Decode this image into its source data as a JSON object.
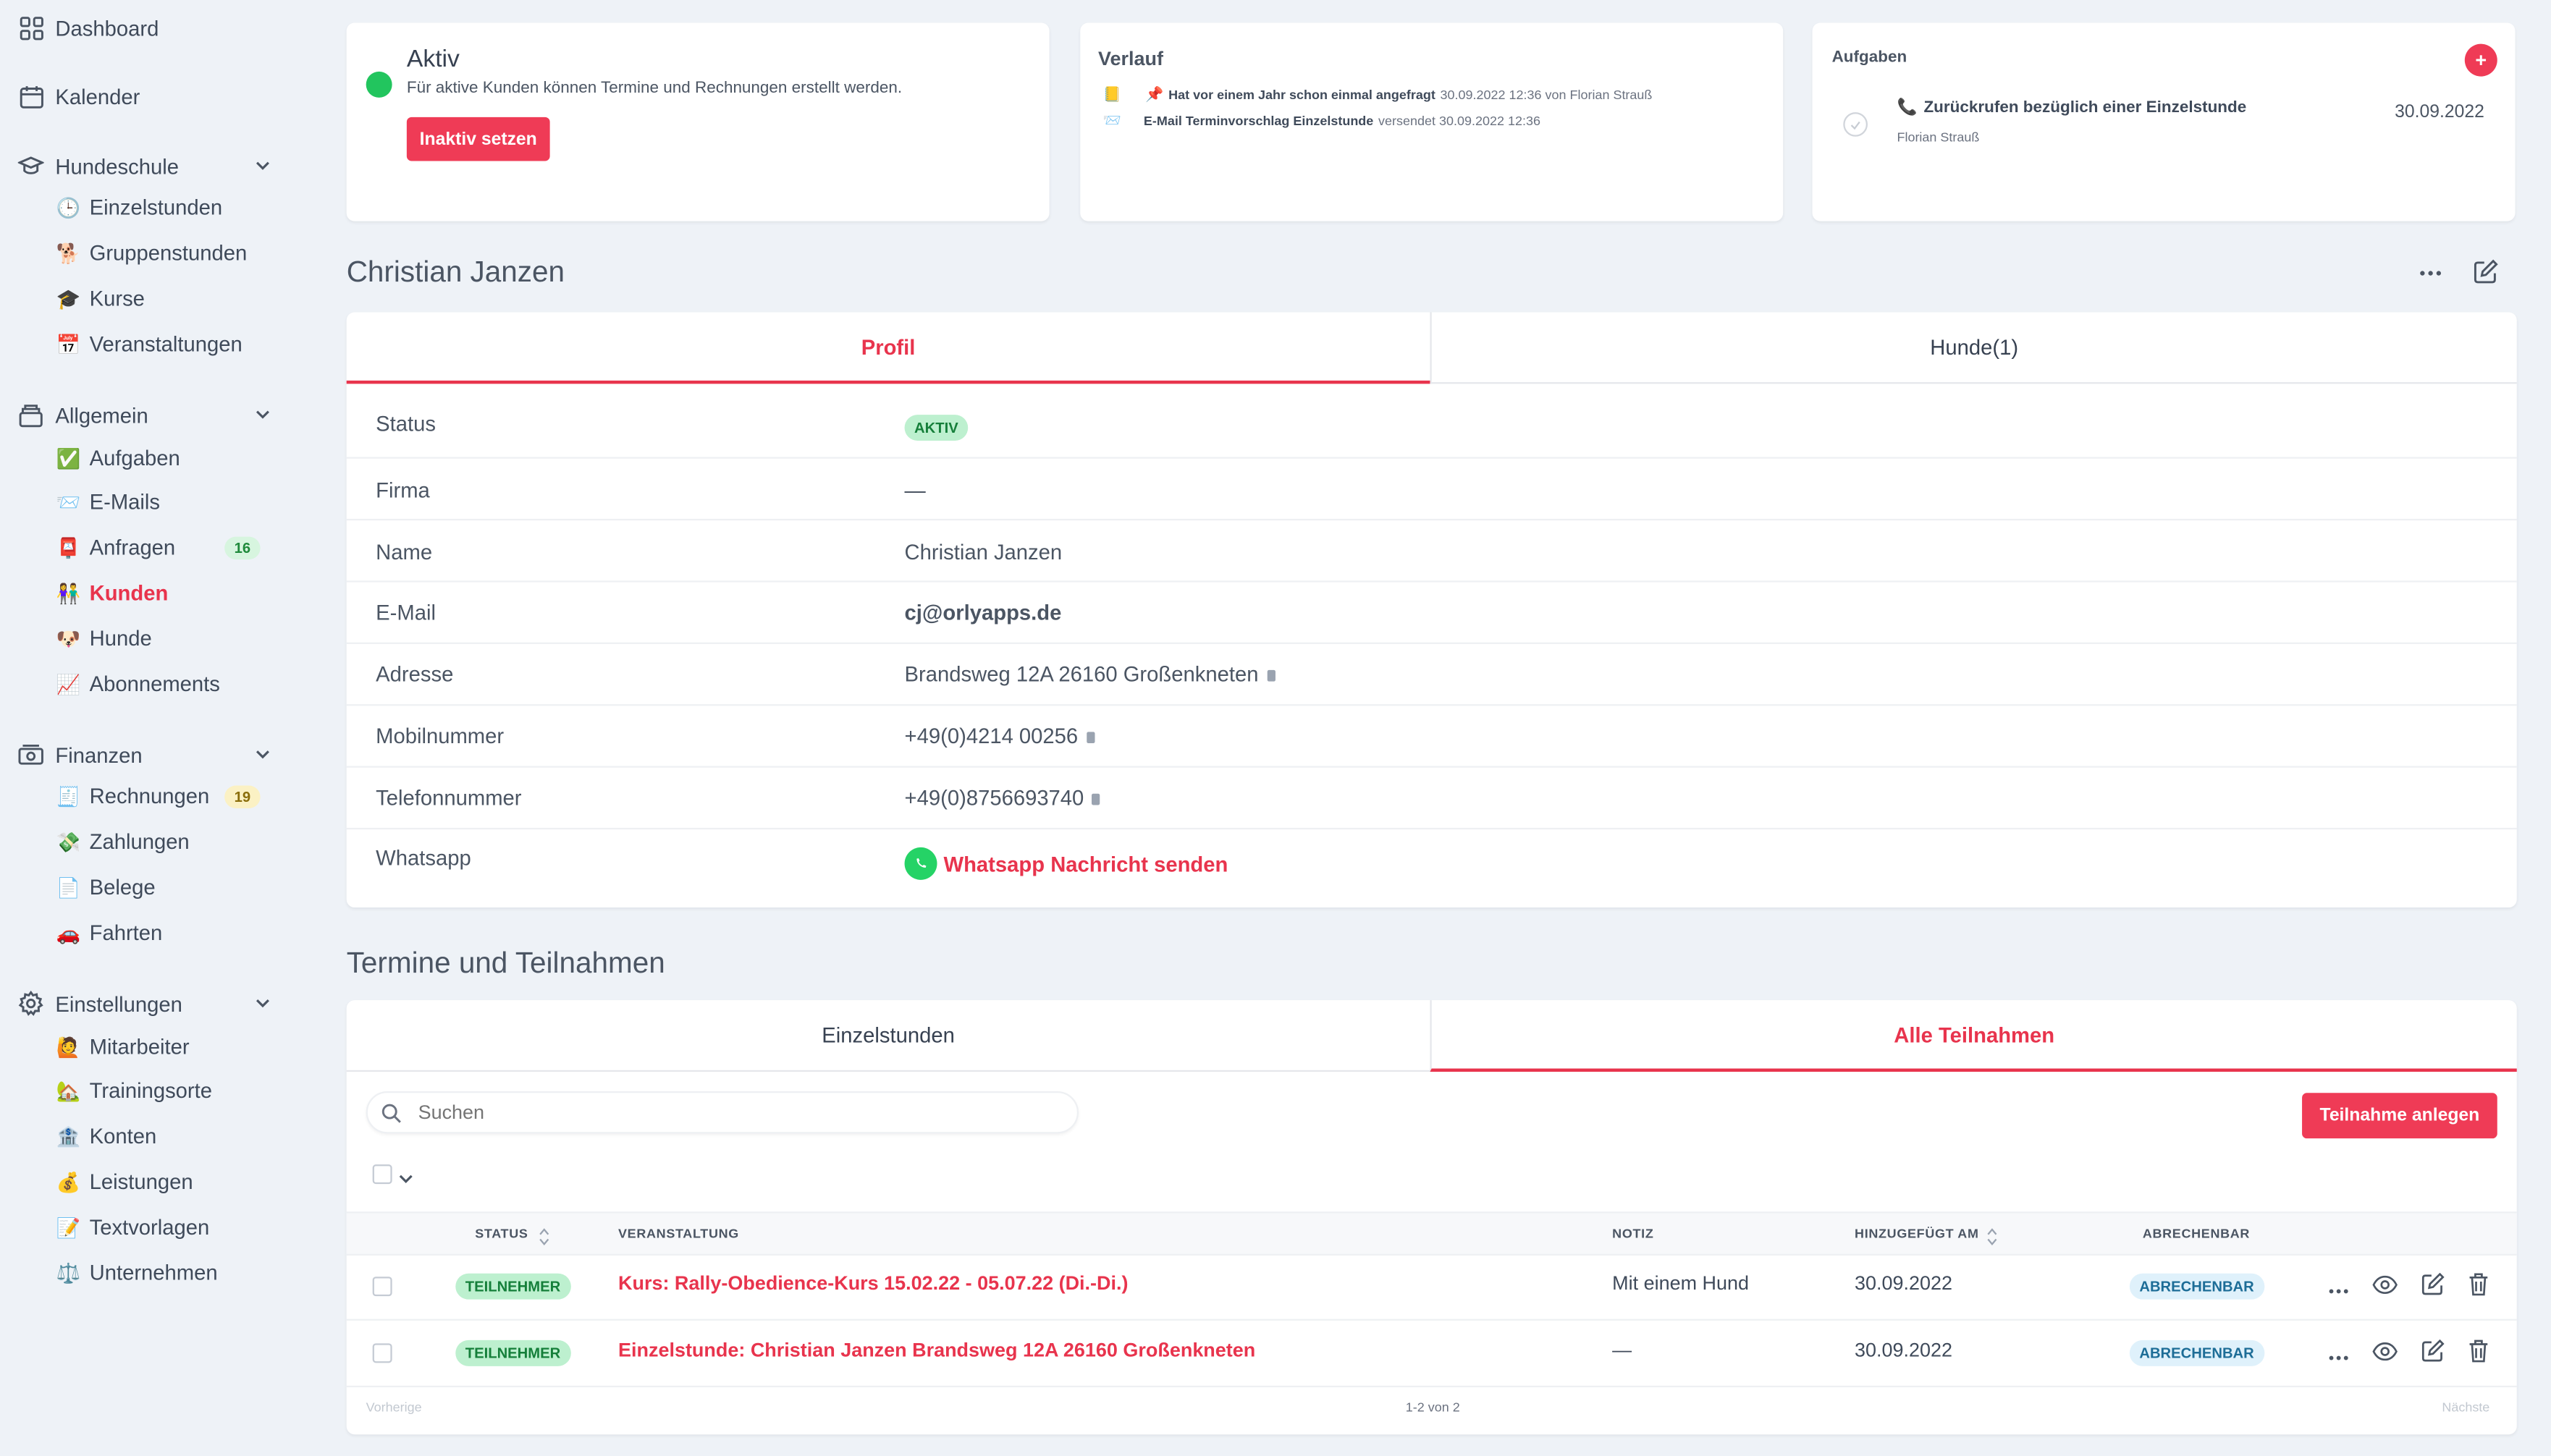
{
  "sidebar": {
    "dashboard": "Dashboard",
    "kalender": "Kalender",
    "hundeschule": {
      "label": "Hundeschule",
      "items": [
        {
          "label": "Einzelstunden",
          "icon": "🕒"
        },
        {
          "label": "Gruppenstunden",
          "icon": "🐕"
        },
        {
          "label": "Kurse",
          "icon": "🎓"
        },
        {
          "label": "Veranstaltungen",
          "icon": "📅"
        }
      ]
    },
    "allgemein": {
      "label": "Allgemein",
      "items": [
        {
          "label": "Aufgaben",
          "icon": "✅"
        },
        {
          "label": "E-Mails",
          "icon": "📨"
        },
        {
          "label": "Anfragen",
          "icon": "📮",
          "badge": "16"
        },
        {
          "label": "Kunden",
          "icon": "👫"
        },
        {
          "label": "Hunde",
          "icon": "🐶"
        },
        {
          "label": "Abonnements",
          "icon": "📈"
        }
      ]
    },
    "finanzen": {
      "label": "Finanzen",
      "items": [
        {
          "label": "Rechnungen",
          "icon": "🧾",
          "badge": "19"
        },
        {
          "label": "Zahlungen",
          "icon": "💸"
        },
        {
          "label": "Belege",
          "icon": "📄"
        },
        {
          "label": "Fahrten",
          "icon": "🚗"
        }
      ]
    },
    "einstellungen": {
      "label": "Einstellungen",
      "items": [
        {
          "label": "Mitarbeiter",
          "icon": "🙋"
        },
        {
          "label": "Trainingsorte",
          "icon": "🏡"
        },
        {
          "label": "Konten",
          "icon": "🏦"
        },
        {
          "label": "Leistungen",
          "icon": "💰"
        },
        {
          "label": "Textvorlagen",
          "icon": "📝"
        },
        {
          "label": "Unternehmen",
          "icon": "⚖️"
        }
      ]
    }
  },
  "status_card": {
    "title": "Aktiv",
    "text": "Für aktive Kunden können Termine und Rechnungen erstellt werden.",
    "button": "Inaktiv setzen"
  },
  "verlauf": {
    "title": "Verlauf",
    "entries": [
      {
        "bold": "Hat vor einem Jahr schon einmal angefragt",
        "rest": "30.09.2022 12:36 von Florian Strauß",
        "icon": "📒",
        "pin": "📌"
      },
      {
        "bold": "E-Mail Terminvorschlag Einzelstunde",
        "rest": "versendet 30.09.2022 12:36",
        "icon": "📨"
      }
    ]
  },
  "aufgaben": {
    "title": "Aufgaben",
    "add": "+",
    "task": {
      "title": "Zurückrufen bezüglich einer Einzelstunde",
      "icon": "📞",
      "person": "Florian Strauß",
      "date": "30.09.2022"
    }
  },
  "customer": {
    "name": "Christian Janzen",
    "tabs": [
      "Profil",
      "Hunde(1)"
    ],
    "fields": {
      "status": {
        "label": "Status",
        "value": "AKTIV"
      },
      "firma": {
        "label": "Firma",
        "value": "—"
      },
      "name": {
        "label": "Name",
        "value": "Christian Janzen"
      },
      "email": {
        "label": "E-Mail",
        "value": "cj@orlyapps.de"
      },
      "adresse": {
        "label": "Adresse",
        "value": "Brandsweg 12A 26160 Großenkneten"
      },
      "mobil": {
        "label": "Mobilnummer",
        "value": "+49(0)4214 00256"
      },
      "telefon": {
        "label": "Telefonnummer",
        "value": "+49(0)8756693740"
      },
      "whatsapp": {
        "label": "Whatsapp",
        "value": "Whatsapp Nachricht senden"
      }
    }
  },
  "termine": {
    "title": "Termine und Teilnahmen",
    "tabs": [
      "Einzelstunden",
      "Alle Teilnahmen"
    ],
    "search_placeholder": "Suchen",
    "add_button": "Teilnahme anlegen",
    "columns": [
      "STATUS",
      "VERANSTALTUNG",
      "NOTIZ",
      "HINZUGEFÜGT AM",
      "ABRECHENBAR"
    ],
    "rows": [
      {
        "status": "TEILNEHMER",
        "veranstaltung": "Kurs: Rally-Obedience-Kurs 15.02.22 - 05.07.22 (Di.-Di.)",
        "notiz": "Mit einem Hund",
        "datum": "30.09.2022",
        "abrechenbar": "ABRECHENBAR"
      },
      {
        "status": "TEILNEHMER",
        "veranstaltung": "Einzelstunde: Christian Janzen Brandsweg 12A 26160 Großenkneten",
        "notiz": "—",
        "datum": "30.09.2022",
        "abrechenbar": "ABRECHENBAR"
      }
    ],
    "pagination": {
      "prev": "Vorherige",
      "info": "1-2 von 2",
      "next": "Nächste"
    }
  },
  "colors": {
    "accent": "#e8344d",
    "status_green": "#22c55e",
    "background": "#eef2f7"
  }
}
